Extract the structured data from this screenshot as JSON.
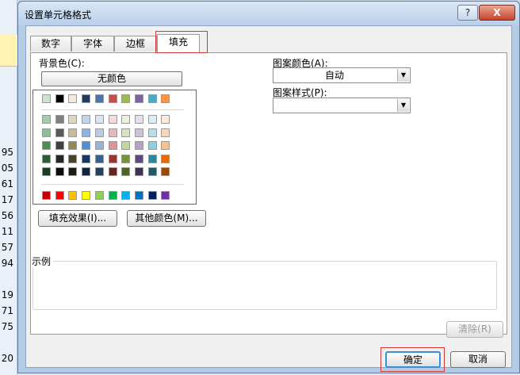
{
  "dialog": {
    "title": "设置单元格格式",
    "help_label": "?",
    "close_label": "X"
  },
  "background_sheet": {
    "row_values": [
      "95",
      "05",
      "61",
      "17",
      "56",
      "11",
      "57",
      "94",
      "19",
      "71",
      "75",
      "20"
    ]
  },
  "tabs": [
    {
      "label": "数字",
      "active": false
    },
    {
      "label": "字体",
      "active": false
    },
    {
      "label": "边框",
      "active": false
    },
    {
      "label": "填充",
      "active": true
    }
  ],
  "fill": {
    "background_color_label": "背景色(C):",
    "no_color_label": "无颜色",
    "fill_effects_label": "填充效果(I)...",
    "more_colors_label": "其他颜色(M)...",
    "pattern_color_label": "图案颜色(A):",
    "pattern_color_value": "自动",
    "pattern_style_label": "图案样式(P):",
    "pattern_style_value": "",
    "sample_label": "示例",
    "clear_label": "清除(R)"
  },
  "palette": {
    "theme_row": [
      "#cfe3d3",
      "#000000",
      "#f2ebdd",
      "#1f3a5c",
      "#4a74b0",
      "#c0504d",
      "#9bbb59",
      "#8064a2",
      "#4bacc6",
      "#f79646"
    ],
    "tint_rows": [
      [
        "#a8c9ad",
        "#7f7f7f",
        "#ddd8c4",
        "#c6d4e8",
        "#dbe5f1",
        "#f2dcdb",
        "#ebf1dd",
        "#e5e0ec",
        "#dbeef3",
        "#fdeada"
      ],
      [
        "#8cbf94",
        "#595959",
        "#c4bd97",
        "#8db3e2",
        "#b8cce4",
        "#e5b9b7",
        "#d7e3bc",
        "#ccc1d9",
        "#b7dde8",
        "#fbd5b5"
      ],
      [
        "#4f8a57",
        "#3f3f3f",
        "#938953",
        "#548dd4",
        "#95b3d7",
        "#d99694",
        "#c3d69b",
        "#b2a2c7",
        "#92cddc",
        "#fac08f"
      ],
      [
        "#2f5a36",
        "#262626",
        "#494429",
        "#17365d",
        "#366092",
        "#953734",
        "#76923c",
        "#5f497a",
        "#31859b",
        "#e36c09"
      ],
      [
        "#1d3a22",
        "#0c0c0c",
        "#1d1b10",
        "#0f243e",
        "#244061",
        "#632423",
        "#4f6128",
        "#3f3151",
        "#205867",
        "#974806"
      ]
    ],
    "standard_row": [
      "#c00000",
      "#ff0000",
      "#ffc000",
      "#ffff00",
      "#92d050",
      "#00b050",
      "#00b0f0",
      "#0070c0",
      "#002060",
      "#7030a0"
    ]
  },
  "footer": {
    "ok_label": "确定",
    "cancel_label": "取消"
  }
}
